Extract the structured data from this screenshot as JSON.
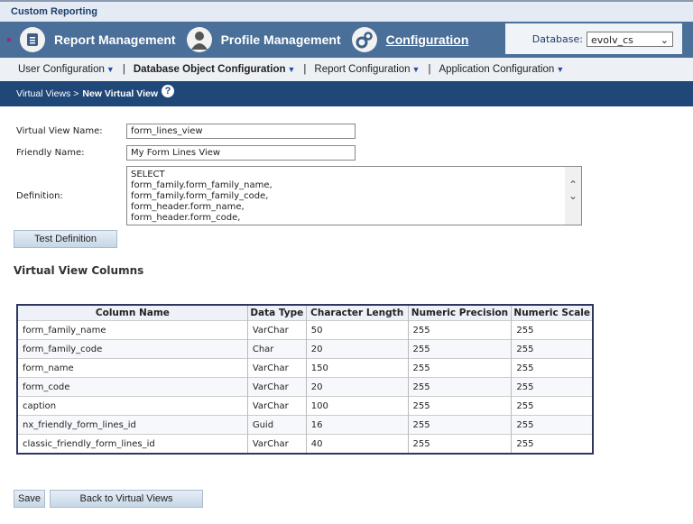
{
  "app_title": "Custom Reporting",
  "nav": [
    {
      "label": "Report Management",
      "icon": "report-icon"
    },
    {
      "label": "Profile Management",
      "icon": "profile-icon"
    },
    {
      "label": "Configuration",
      "icon": "gears-icon"
    }
  ],
  "database": {
    "label": "Database:",
    "value": "evolv_cs"
  },
  "subnav": [
    "User Configuration",
    "Database Object Configuration",
    "Report Configuration",
    "Application Configuration"
  ],
  "breadcrumb": {
    "parent": "Virtual Views >",
    "current": "New Virtual View",
    "help": "?"
  },
  "form": {
    "name_label": "Virtual View Name:",
    "name_value": "form_lines_view",
    "friendly_label": "Friendly Name:",
    "friendly_value": "My Form Lines View",
    "definition_label": "Definition:",
    "definition_value": "SELECT\nform_family.form_family_name,\nform_family.form_family_code,\nform_header.form_name,\nform_header.form_code,",
    "test_button": "Test Definition"
  },
  "columns_title": "Virtual View Columns",
  "table": {
    "headers": [
      "Column Name",
      "Data Type",
      "Character Length",
      "Numeric Precision",
      "Numeric Scale"
    ],
    "rows": [
      [
        "form_family_name",
        "VarChar",
        "50",
        "255",
        "255"
      ],
      [
        "form_family_code",
        "Char",
        "20",
        "255",
        "255"
      ],
      [
        "form_name",
        "VarChar",
        "150",
        "255",
        "255"
      ],
      [
        "form_code",
        "VarChar",
        "20",
        "255",
        "255"
      ],
      [
        "caption",
        "VarChar",
        "100",
        "255",
        "255"
      ],
      [
        "nx_friendly_form_lines_id",
        "Guid",
        "16",
        "255",
        "255"
      ],
      [
        "classic_friendly_form_lines_id",
        "VarChar",
        "40",
        "255",
        "255"
      ]
    ]
  },
  "buttons": {
    "save": "Save",
    "back": "Back to Virtual Views"
  }
}
